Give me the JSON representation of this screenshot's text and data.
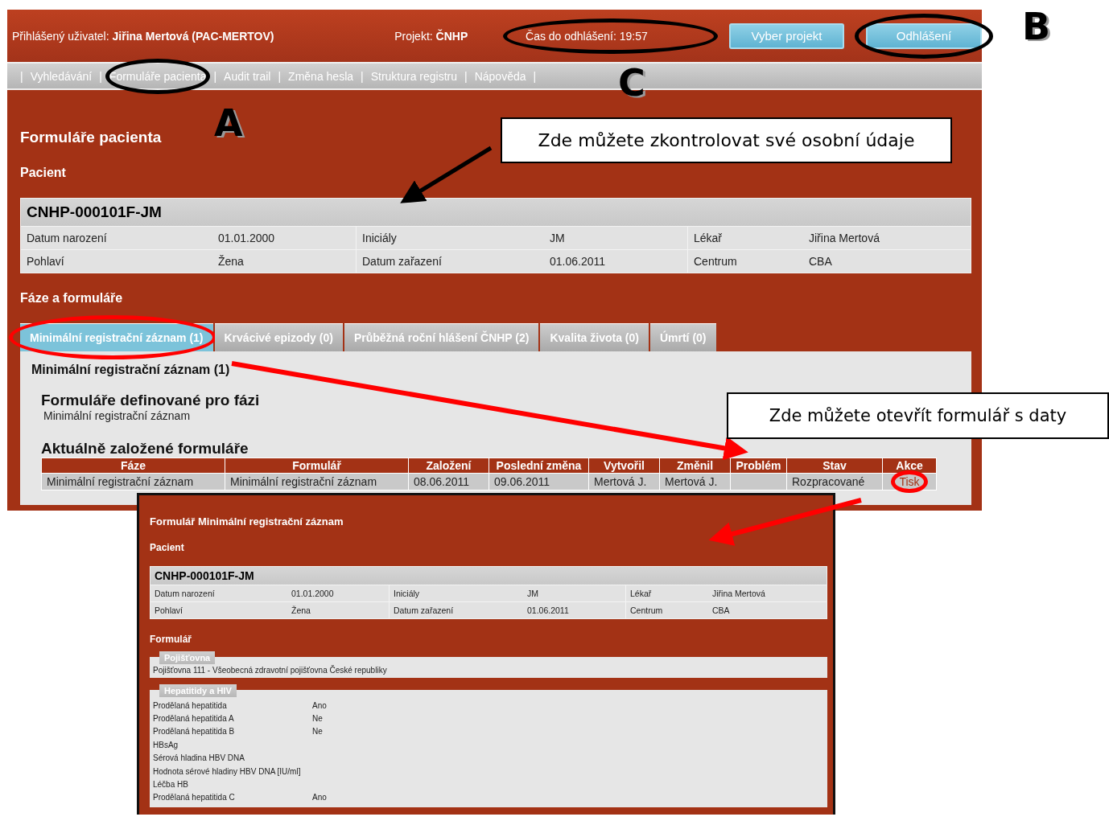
{
  "header": {
    "user_label": "Přihlášený uživatel:",
    "user_name": "Jiřina Mertová (PAC-MERTOV)",
    "project_label": "Projekt:",
    "project": "ČNHP",
    "timeout": "Čas do odhlášení: 19:57",
    "buttons": [
      {
        "label": "Vyber projekt"
      },
      {
        "label": "Odhlášení"
      }
    ]
  },
  "nav": {
    "separator": "|",
    "items": [
      "Vyhledávání",
      "Formuláře pacienta",
      "Audit trail",
      "Změna hesla",
      "Struktura registru",
      "Nápověda"
    ]
  },
  "page_title": "Formuláře pacienta",
  "patient_heading": "Pacient",
  "patient": {
    "id": "CNHP-000101F-JM",
    "fields": [
      {
        "label": "Datum narození",
        "value": "01.01.2000"
      },
      {
        "label": "Iniciály",
        "value": "JM"
      },
      {
        "label": "Lékař",
        "value": "Jiřina Mertová"
      },
      {
        "label": "Pohlaví",
        "value": "Žena"
      },
      {
        "label": "Datum zařazení",
        "value": "01.06.2011"
      },
      {
        "label": "Centrum",
        "value": "CBA"
      }
    ]
  },
  "phases_heading": "Fáze a formuláře",
  "tabs": [
    {
      "label": "Minimální registrační záznam (1)",
      "selected": true
    },
    {
      "label": "Krvácivé epizody (0)",
      "selected": false
    },
    {
      "label": "Průběžná roční hlášení ČNHP (2)",
      "selected": false
    },
    {
      "label": "Kvalita života (0)",
      "selected": false
    },
    {
      "label": "Úmrtí (0)",
      "selected": false
    }
  ],
  "phase_panel": {
    "title": "Minimální registrační záznam (1)",
    "defined_heading": "Formuláře definované pro fázi",
    "defined_forms": [
      "Minimální registrační záznam"
    ],
    "current_heading": "Aktuálně založené formuláře",
    "table": {
      "columns": [
        "Fáze",
        "Formulář",
        "Založení",
        "Poslední změna",
        "Vytvořil",
        "Změnil",
        "Problém",
        "Stav",
        "Akce"
      ],
      "rows": [
        {
          "cells": [
            "Minimální registrační záznam",
            "Minimální registrační záznam",
            "08.06.2011",
            "09.06.2011",
            "Mertová J.",
            "Mertová J.",
            "",
            "Rozpracované"
          ],
          "action": "Tisk"
        }
      ]
    }
  },
  "popup": {
    "title": "Formulář Minimální registrační záznam",
    "patient_heading": "Pacient",
    "patient": {
      "id": "CNHP-000101F-JM",
      "fields": [
        {
          "label": "Datum narození",
          "value": "01.01.2000"
        },
        {
          "label": "Iniciály",
          "value": "JM"
        },
        {
          "label": "Lékař",
          "value": "Jiřina Mertová"
        },
        {
          "label": "Pohlaví",
          "value": "Žena"
        },
        {
          "label": "Datum zařazení",
          "value": "01.06.2011"
        },
        {
          "label": "Centrum",
          "value": "CBA"
        }
      ]
    },
    "form_heading": "Formulář",
    "sections": [
      {
        "title": "Pojišťovna",
        "kind": "text",
        "text": "Pojišťovna 111 - Všeobecná zdravotní pojišťovna České republiky"
      },
      {
        "title": "Hepatitidy a HIV",
        "kind": "pairs",
        "rows": [
          {
            "label": "Prodělaná hepatitida",
            "value": "Ano"
          },
          {
            "label": "Prodělaná hepatitida A",
            "value": "Ne"
          },
          {
            "label": "Prodělaná hepatitida B",
            "value": "Ne"
          },
          {
            "label": "HBsAg",
            "value": ""
          },
          {
            "label": "Sérová hladina HBV DNA",
            "value": ""
          },
          {
            "label": "Hodnota sérové hladiny HBV DNA [IU/ml]",
            "value": ""
          },
          {
            "label": "Léčba HB",
            "value": ""
          },
          {
            "label": "Prodělaná hepatitida C",
            "value": "Ano"
          }
        ]
      }
    ]
  },
  "annotations": {
    "markers": [
      "A",
      "B",
      "C"
    ],
    "callouts": [
      "Zde můžete zkontrolovat své osobní údaje",
      "Zde můžete otevřít formulář s daty"
    ]
  }
}
